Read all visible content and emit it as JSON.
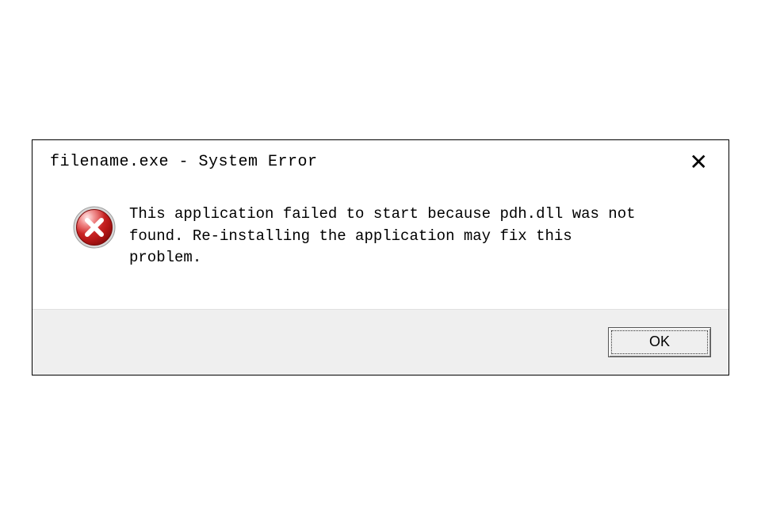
{
  "dialog": {
    "title": "filename.exe - System Error",
    "icon": "error-icon",
    "message": "This application failed to start because pdh.dll was not found. Re-installing the application may fix this problem.",
    "ok_label": "OK"
  }
}
